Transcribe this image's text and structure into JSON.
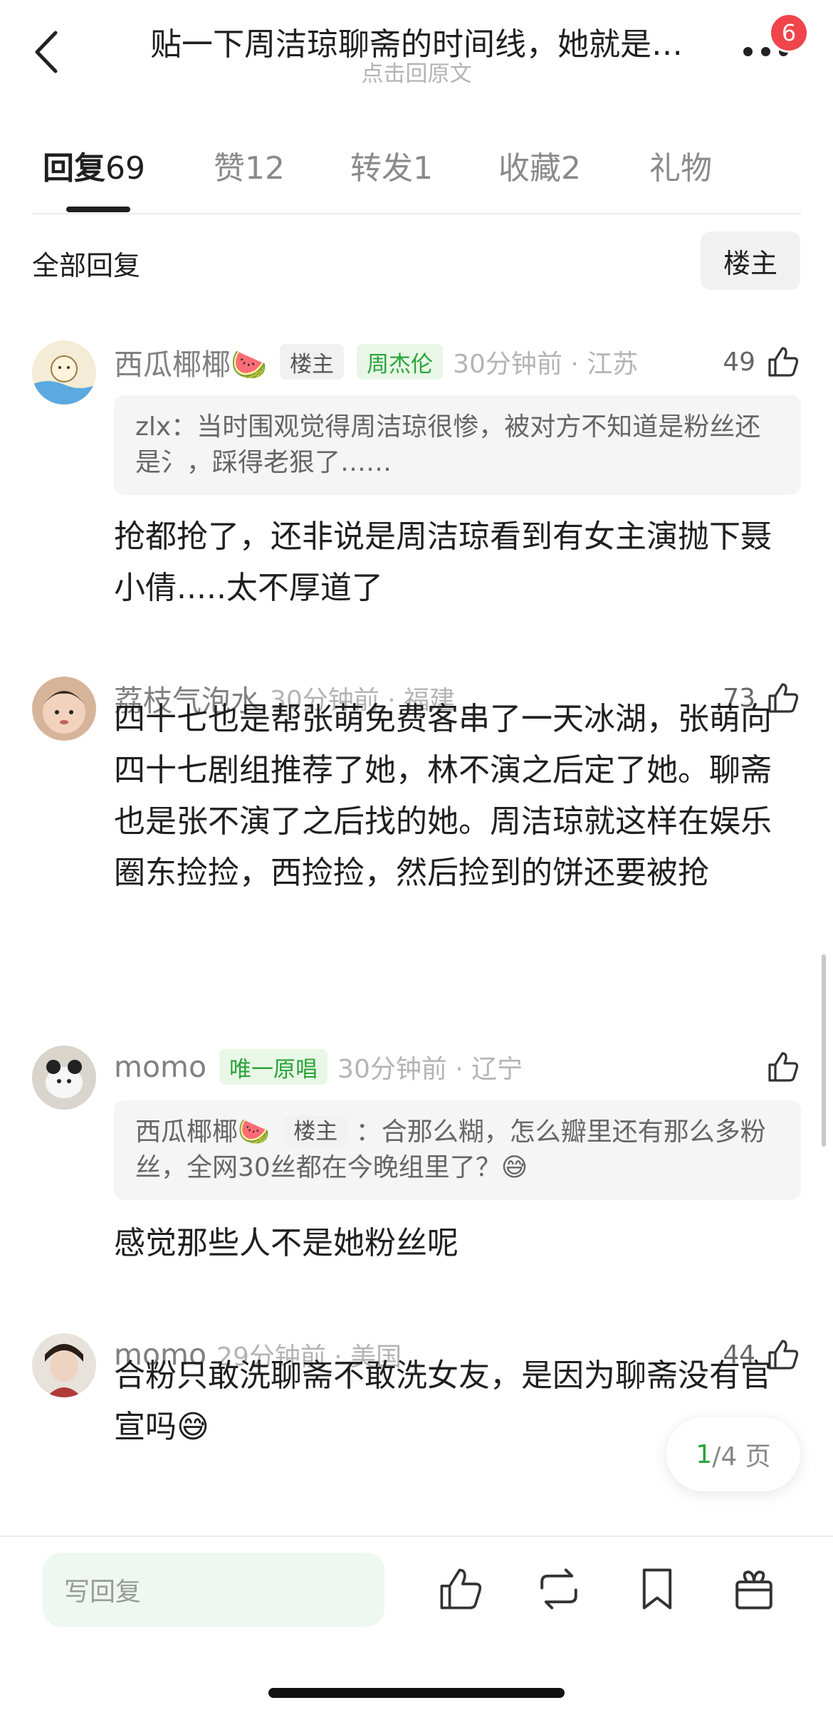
{
  "header": {
    "title": "贴一下周洁琼聊斋的时间线，她就是…",
    "subtitle": "点击回原文",
    "notification_count": "6",
    "back_icon": "chevron-left-icon",
    "more_icon": "more-dots-icon"
  },
  "tabs": [
    {
      "label": "回复",
      "count": "69",
      "active": true
    },
    {
      "label": "赞",
      "count": "12",
      "active": false
    },
    {
      "label": "转发",
      "count": "1",
      "active": false
    },
    {
      "label": "收藏",
      "count": "2",
      "active": false
    },
    {
      "label": "礼物",
      "count": "",
      "active": false
    }
  ],
  "filter": {
    "title": "全部回复",
    "owner_button": "楼主"
  },
  "comments": [
    {
      "username": "西瓜椰椰🍉",
      "tags": [
        "楼主",
        "周杰伦"
      ],
      "time": "30分钟前 · 江苏",
      "likes": "49",
      "quote": "zlx：当时围观觉得周洁琼很惨，被对方不知道是粉丝还是氵，踩得老狠了……",
      "body": "抢都抢了，还非说是周洁琼看到有女主演抛下聂小倩.....太不厚道了"
    },
    {
      "username": "荔枝气泡水",
      "tags": [],
      "time": "30分钟前 · 福建",
      "likes": "73",
      "quote": "",
      "body": "四十七也是帮张萌免费客串了一天冰湖，张萌向四十七剧组推荐了她，林不演之后定了她。聊斋也是张不演了之后找的她。周洁琼就这样在娱乐圈东捡捡，西捡捡，然后捡到的饼还要被抢"
    },
    {
      "username": "momo",
      "tags": [
        "唯一原唱"
      ],
      "time": "30分钟前 · 辽宁",
      "likes": "",
      "quote_user": "西瓜椰椰🍉",
      "quote_tag": "楼主",
      "quote": "：合那么糊，怎么瓣里还有那么多粉丝，全网30丝都在今晚组里了？😅",
      "body": "感觉那些人不是她粉丝呢"
    },
    {
      "username": "momo",
      "tags": [],
      "time": "29分钟前 · 美国",
      "likes": "44",
      "quote": "",
      "body": "合粉只敢洗聊斋不敢洗女友，是因为聊斋没有官宣吗😅"
    }
  ],
  "pager": {
    "current": "1",
    "total": "/4 页"
  },
  "bottom_bar": {
    "reply_placeholder": "写回复",
    "icons": [
      "thumbs-up-icon",
      "repost-icon",
      "bookmark-icon",
      "gift-icon"
    ]
  },
  "colors": {
    "accent_green": "#2aa33a",
    "badge_red": "#f0454b"
  }
}
